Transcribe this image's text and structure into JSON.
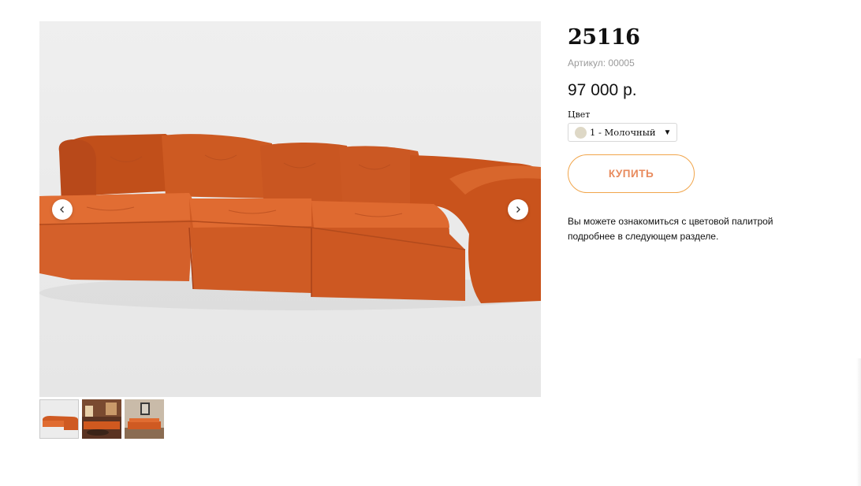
{
  "product": {
    "title": "25116",
    "sku": "Артикул: 00005",
    "price": "97 000 р.",
    "color_label": "Цвет",
    "color_selected": "1 - Молочный",
    "buy_label": "КУПИТЬ",
    "note": "Вы можете ознакомиться с цветовой палитрой подробнее в следующем разделе."
  },
  "colors": {
    "accent_border": "#f1a54b",
    "accent_text": "#e88a5c",
    "swatch": "#ded8c6",
    "sofa": "#d35a20"
  },
  "icons": {
    "prev": "chevron-left-icon",
    "next": "chevron-right-icon",
    "select": "caret-down-icon"
  },
  "gallery": {
    "thumbnail_count": 3,
    "active_thumbnail": 1
  }
}
